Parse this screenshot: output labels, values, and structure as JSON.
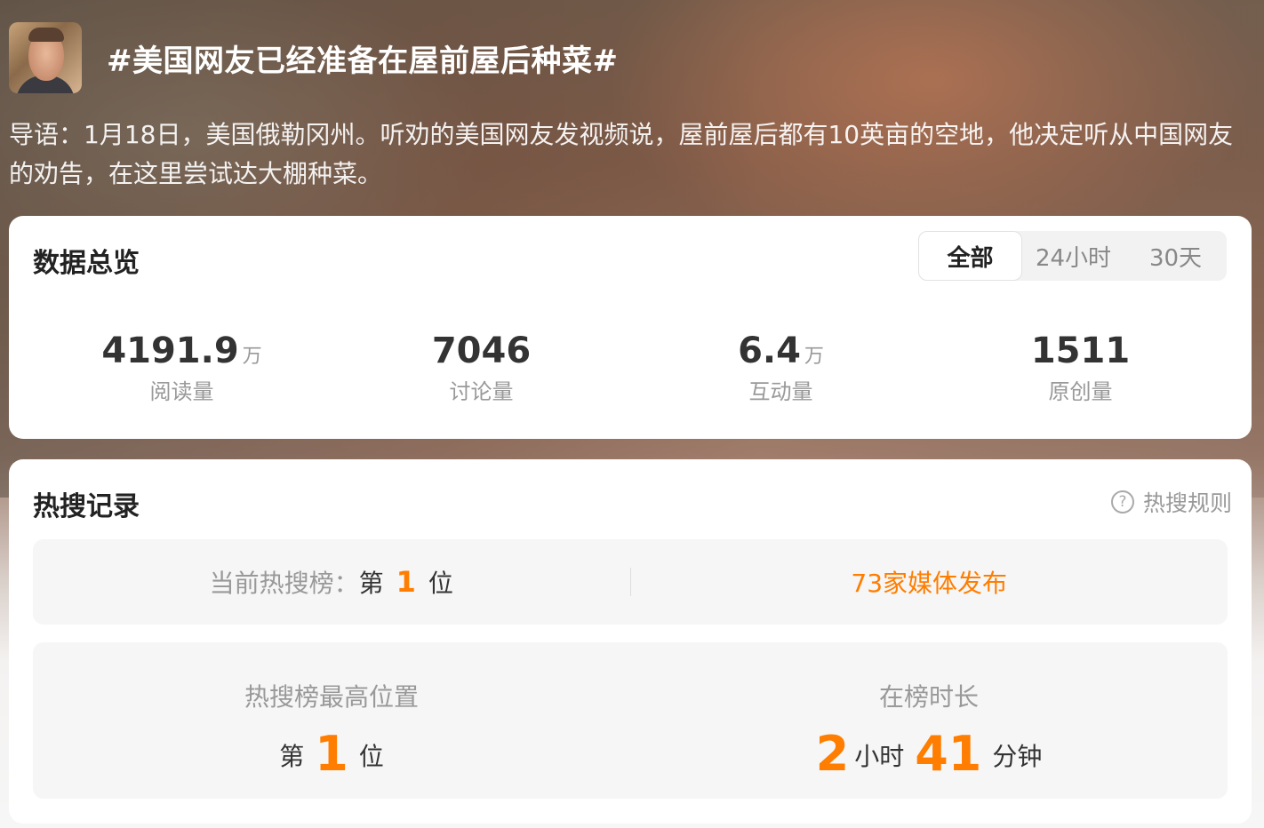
{
  "header": {
    "title": "#美国网友已经准备在屋前屋后种菜#",
    "intro": "导语：1月18日，美国俄勒冈州。听劝的美国网友发视频说，屋前屋后都有10英亩的空地，他决定听从中国网友的劝告，在这里尝试达大棚种菜。"
  },
  "overview": {
    "title": "数据总览",
    "tabs": [
      "全部",
      "24小时",
      "30天"
    ],
    "active_tab": "全部",
    "stats": [
      {
        "value": "4191.9",
        "unit": "万",
        "label": "阅读量"
      },
      {
        "value": "7046",
        "unit": "",
        "label": "讨论量"
      },
      {
        "value": "6.4",
        "unit": "万",
        "label": "互动量"
      },
      {
        "value": "1511",
        "unit": "",
        "label": "原创量"
      }
    ]
  },
  "hotsearch": {
    "title": "热搜记录",
    "rules_label": "热搜规则",
    "current_label": "当前热搜榜：",
    "current_prefix": "第",
    "current_rank": "1",
    "current_suffix": "位",
    "media_text": "73家媒体发布",
    "peak_label": "热搜榜最高位置",
    "peak_prefix": "第",
    "peak_rank": "1",
    "peak_suffix": "位",
    "duration_label": "在榜时长",
    "duration_hours": "2",
    "hours_unit": "小时",
    "duration_minutes": "41",
    "minutes_unit": "分钟"
  },
  "colors": {
    "accent": "#ff7d00",
    "text_dark": "#333333",
    "text_muted": "#999999"
  },
  "icons": {
    "avatar": "avatar-photo",
    "rules": "question-circle-icon"
  }
}
